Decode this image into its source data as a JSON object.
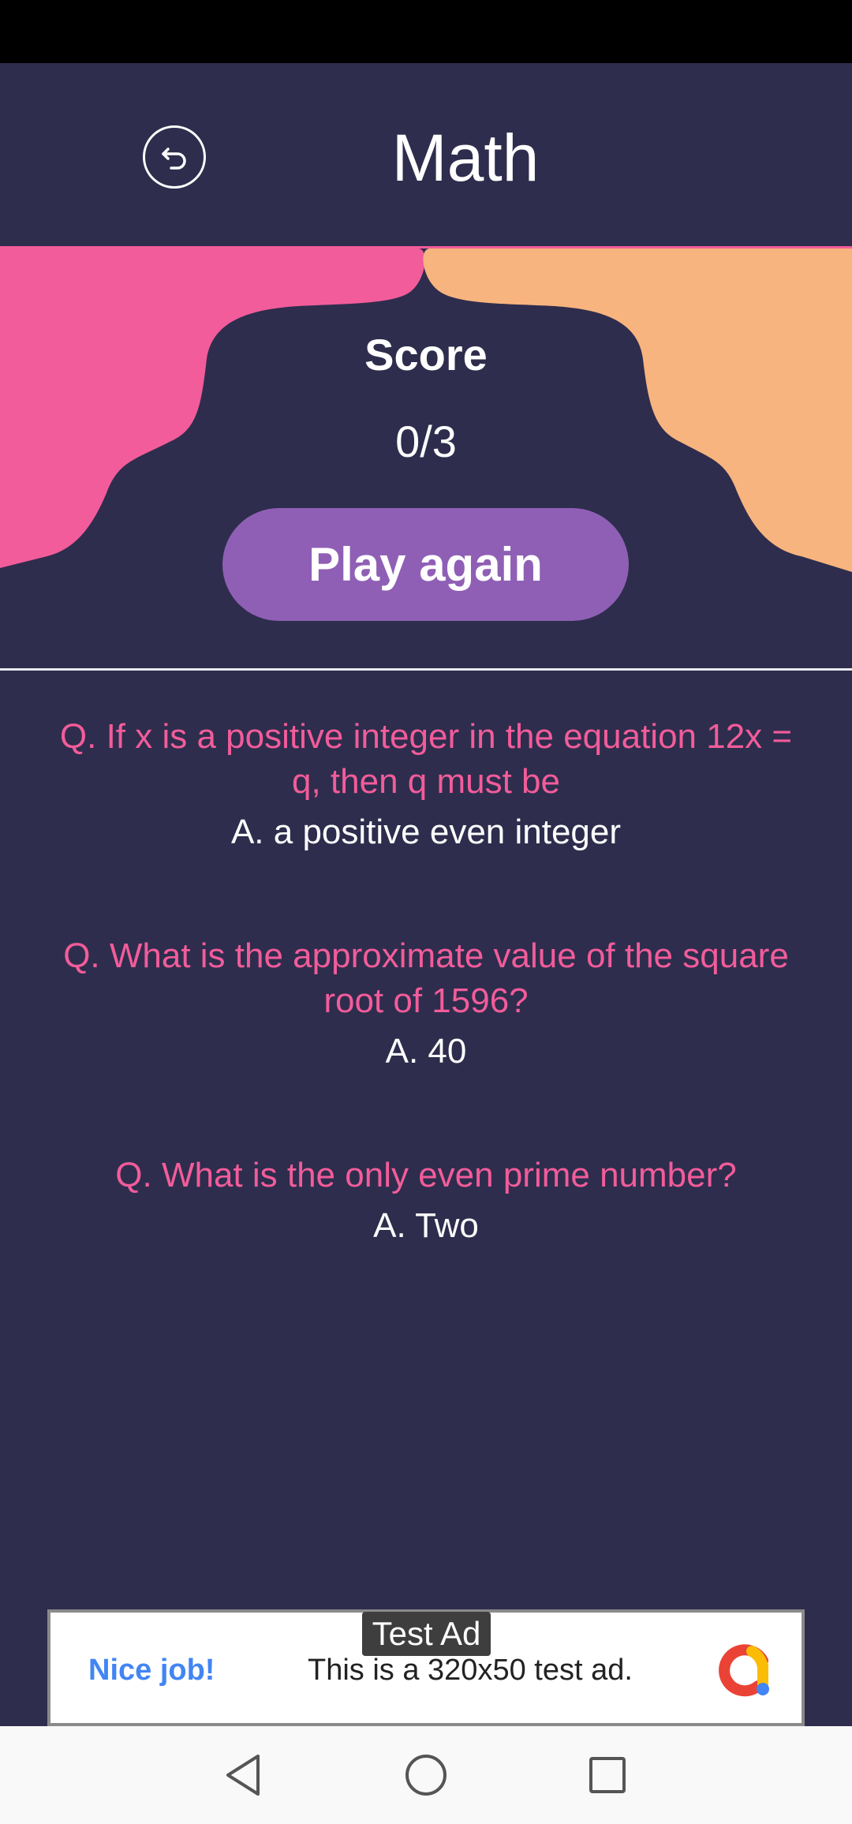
{
  "header": {
    "title": "Math"
  },
  "score": {
    "label": "Score",
    "value": "0/3",
    "play_again_label": "Play again"
  },
  "questions": [
    {
      "question": "Q. If x is a positive integer in the equation 12x = q, then q must be",
      "answer": "A. a positive even integer"
    },
    {
      "question": "Q. What is the approximate value of the square root of 1596?",
      "answer": "A. 40"
    },
    {
      "question": "Q. What is the only even prime number?",
      "answer": "A. Two"
    }
  ],
  "ad": {
    "tag": "Test Ad",
    "headline": "Nice job!",
    "text": "This is a 320x50 test ad."
  },
  "icons": {
    "back": "back-arrow-icon",
    "nav_back": "nav-back-icon",
    "nav_home": "nav-home-icon",
    "nav_recents": "nav-recents-icon"
  },
  "colors": {
    "background": "#2e2d4d",
    "question": "#f25c9a",
    "button": "#8f5fb5",
    "blob_left": "#f25c9a",
    "blob_right": "#f8b47e"
  }
}
